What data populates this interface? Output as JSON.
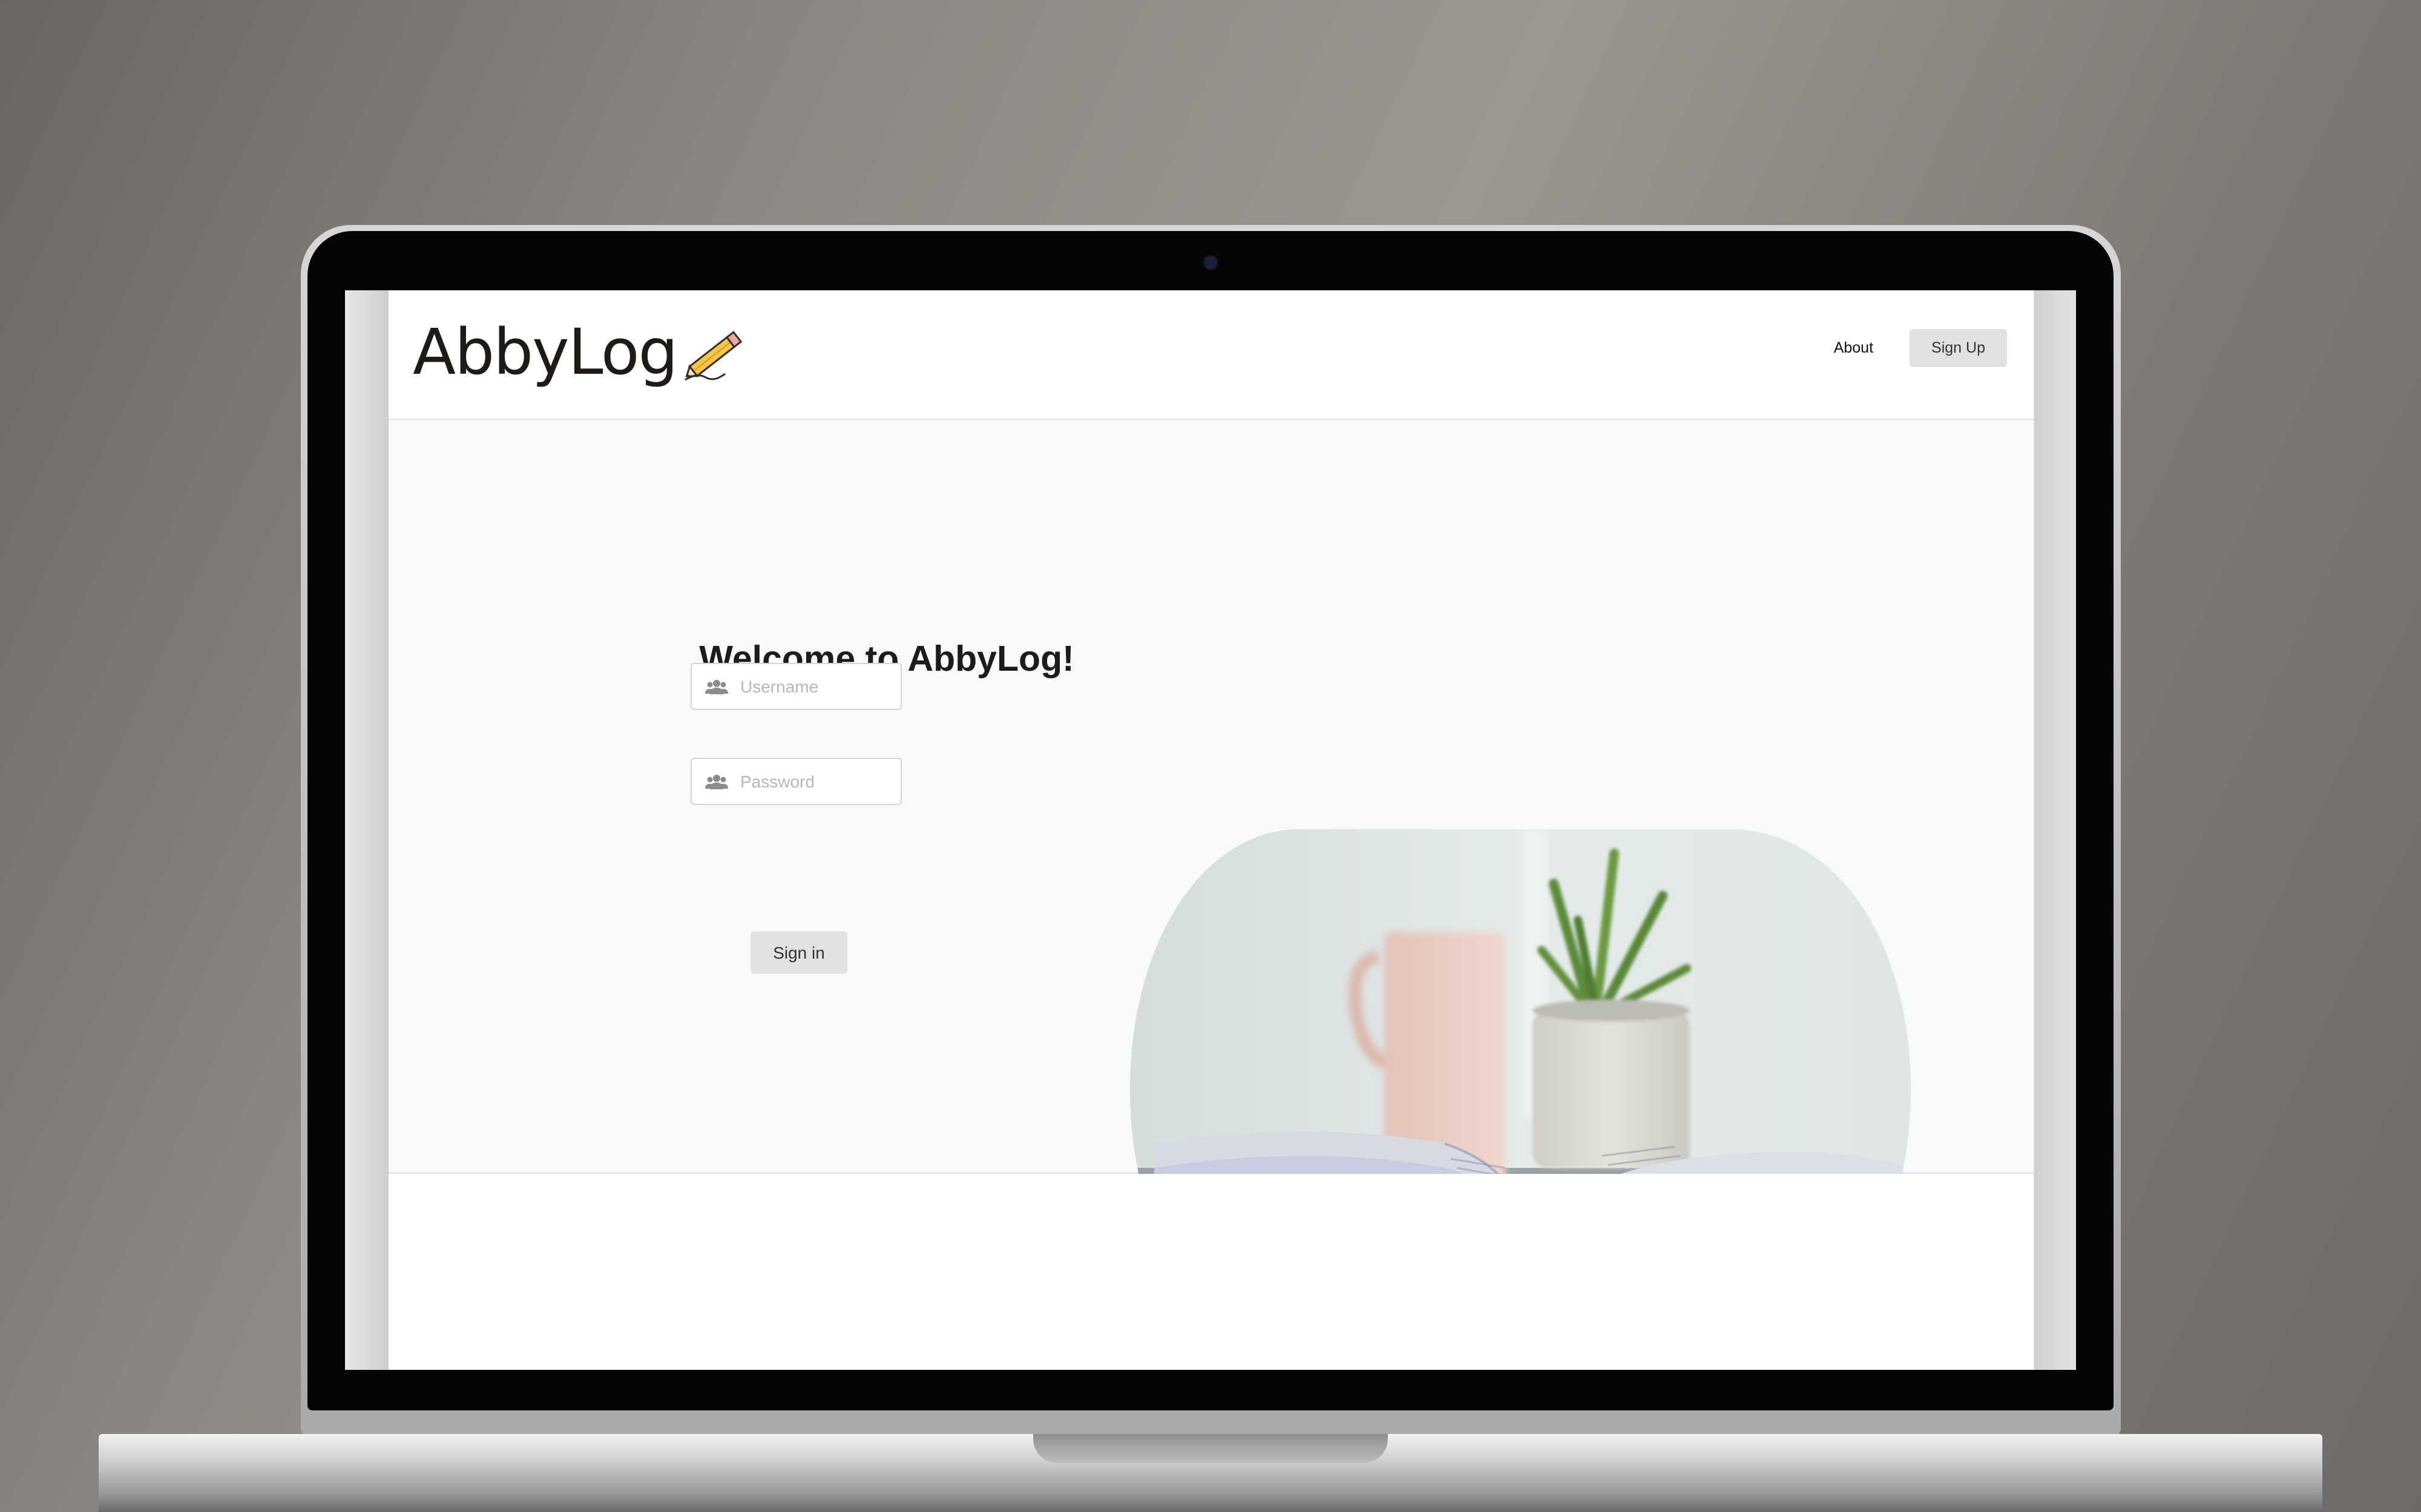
{
  "app": {
    "logo_text": "AbbyLog"
  },
  "nav": {
    "about_label": "About",
    "signup_label": "Sign Up"
  },
  "login": {
    "heading": "Welcome to AbbyLog!",
    "username_placeholder": "Username",
    "password_placeholder": "Password",
    "signin_label": "Sign in"
  },
  "icons": {
    "username_icon": "users-icon",
    "password_icon": "users-icon",
    "logo_icon": "pencil-icon"
  },
  "colors": {
    "nav_button_bg": "#e0e1e2",
    "hero_bg": "#f8f9fa",
    "text_dark": "#1b1c1d",
    "placeholder": "#b7b7b7"
  }
}
